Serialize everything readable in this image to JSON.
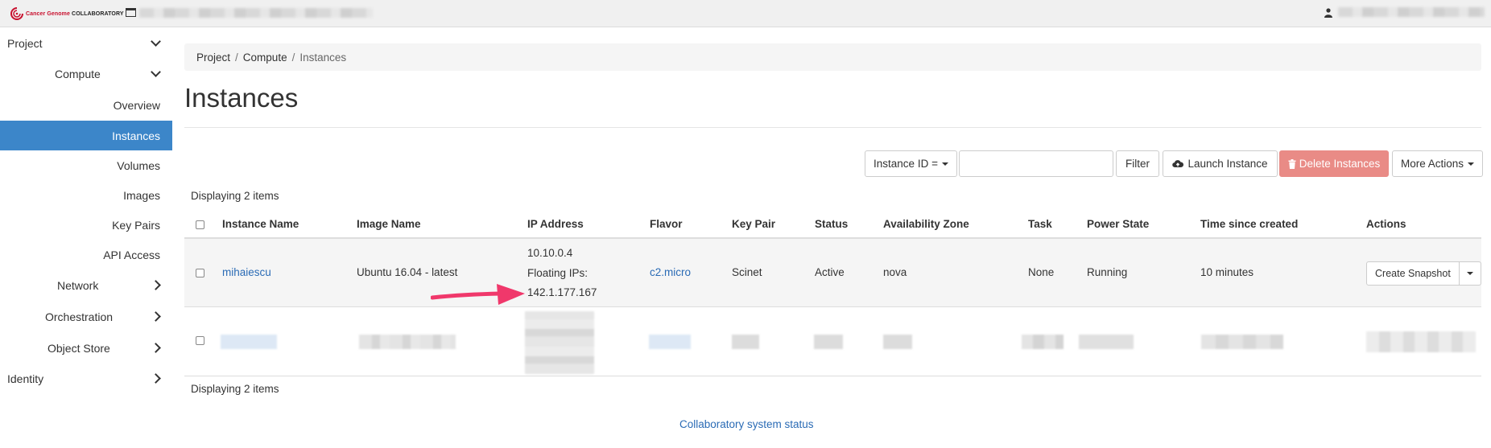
{
  "topbar": {
    "logo_part1": "Cancer",
    "logo_part2": "Genome",
    "logo_part3": "COLLABORATORY"
  },
  "sidebar": {
    "project": "Project",
    "compute": "Compute",
    "overview": "Overview",
    "instances": "Instances",
    "volumes": "Volumes",
    "images": "Images",
    "key_pairs": "Key Pairs",
    "api_access": "API Access",
    "network": "Network",
    "orchestration": "Orchestration",
    "object_store": "Object Store",
    "identity": "Identity"
  },
  "breadcrumb": {
    "project": "Project",
    "compute": "Compute",
    "current": "Instances",
    "sep": "/"
  },
  "page": {
    "title": "Instances"
  },
  "toolbar": {
    "filter_field": "Instance ID =",
    "filter_value": "",
    "filter_button": "Filter",
    "launch_button": "Launch Instance",
    "delete_button": "Delete Instances",
    "more_actions": "More Actions"
  },
  "table": {
    "count_top": "Displaying 2 items",
    "count_bottom": "Displaying 2 items",
    "headers": {
      "name": "Instance Name",
      "image": "Image Name",
      "ip": "IP Address",
      "flavor": "Flavor",
      "key_pair": "Key Pair",
      "status": "Status",
      "zone": "Availability Zone",
      "task": "Task",
      "power": "Power State",
      "time": "Time since created",
      "actions": "Actions"
    },
    "row1": {
      "name": "mihaiescu",
      "image": "Ubuntu 16.04 - latest",
      "ip_fixed": "10.10.0.4",
      "floating_label": "Floating IPs:",
      "ip_floating": "142.1.177.167",
      "flavor": "c2.micro",
      "key_pair": "Scinet",
      "status": "Active",
      "zone": "nova",
      "task": "None",
      "power": "Running",
      "time": "10 minutes",
      "action": "Create Snapshot"
    }
  },
  "footer": {
    "status_link": "Collaboratory system status"
  },
  "colors": {
    "active_nav": "#3c86c9",
    "link": "#2a6bb5",
    "danger": "#e98b86",
    "arrow": "#f0386b"
  }
}
